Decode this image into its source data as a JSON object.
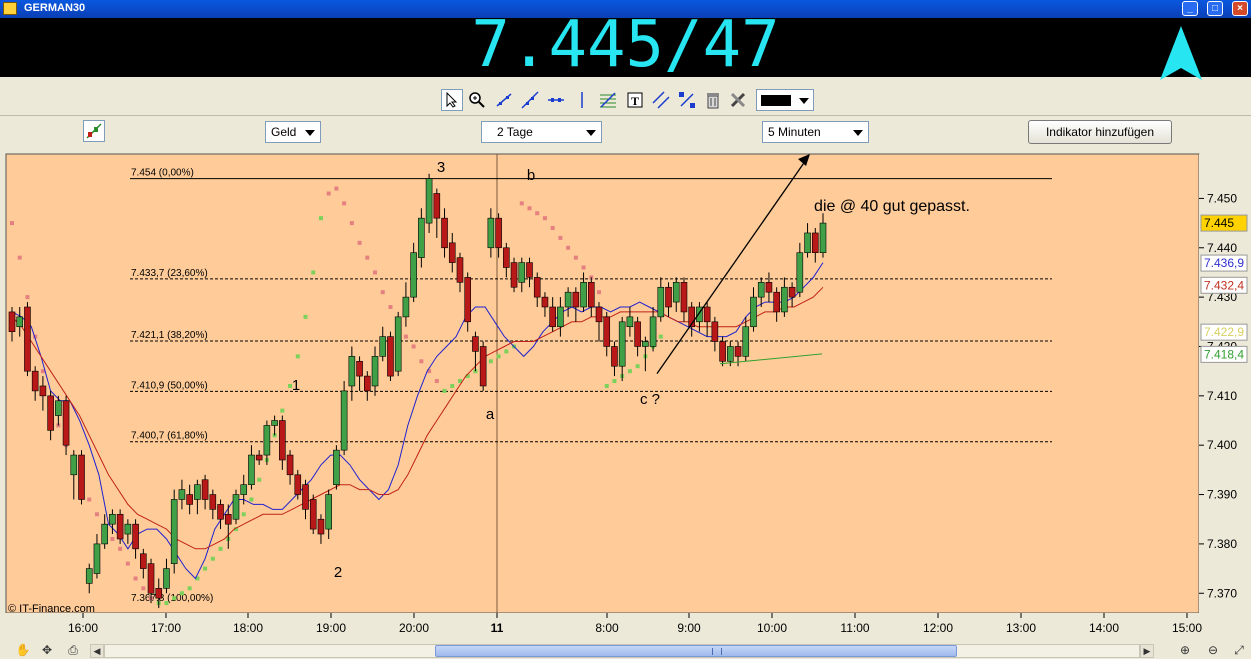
{
  "window": {
    "title": "GERMAN30",
    "buttons": [
      "_",
      "□",
      "×"
    ]
  },
  "quote": {
    "price": "7.445/47",
    "direction_icon": "up-arrow-icon",
    "color": "#27e6f2"
  },
  "toolbar": {
    "tools": [
      "cursor-icon",
      "zoom-icon",
      "line-icon",
      "trendline-icon",
      "horizontal-line-icon",
      "fibonacci-icon",
      "text-icon",
      "parallel-icon",
      "expand-icon",
      "trash-icon",
      "tools-icon"
    ],
    "color_value": "#000000"
  },
  "options": {
    "side": "Geld",
    "range": "2 Tage",
    "interval": "5 Minuten",
    "add_indicator": "Indikator hinzufügen"
  },
  "chart_data": {
    "type": "candlestick",
    "symbol": "GERMAN30",
    "watermark": "© IT-Finance.com",
    "x_labels": [
      "16:00",
      "17:00",
      "18:00",
      "19:00",
      "20:00",
      "11",
      "8:00",
      "9:00",
      "10:00",
      "11:00",
      "12:00",
      "13:00",
      "14:00",
      "15:00"
    ],
    "y_ticks": [
      "7.450",
      "7.440",
      "7.430",
      "7.420",
      "7.410",
      "7.400",
      "7.390",
      "7.380",
      "7.370"
    ],
    "ylim": [
      7.366,
      7.459
    ],
    "price_badges": [
      {
        "label": "7.445",
        "value": 7.445,
        "color": "#ffd200",
        "text": "#000"
      },
      {
        "label": "7.436,9",
        "value": 7.4369,
        "color": "#ffffff",
        "text": "#3030d0"
      },
      {
        "label": "7.432,4",
        "value": 7.4324,
        "color": "#ffffff",
        "text": "#c03020"
      },
      {
        "label": "7.422,9",
        "value": 7.4229,
        "color": "#ffffff",
        "text": "#d8d060"
      },
      {
        "label": "7.418,4",
        "value": 7.4184,
        "color": "#ffffff",
        "text": "#30a030"
      }
    ],
    "fib_levels": [
      {
        "label": "7.454 (0,00%)",
        "value": 7.454
      },
      {
        "label": "7.433,7 (23,60%)",
        "value": 7.4337
      },
      {
        "label": "7.421,1 (38,20%)",
        "value": 7.4211
      },
      {
        "label": "7.410,9 (50,00%)",
        "value": 7.4109
      },
      {
        "label": "7.400,7 (61,80%)",
        "value": 7.4007
      },
      {
        "label": "7.367,8 (100,00%)",
        "value": 7.3678
      }
    ],
    "annotations": [
      {
        "text": "3",
        "id": "wave-3"
      },
      {
        "text": "b",
        "id": "wave-b"
      },
      {
        "text": "1",
        "id": "wave-1"
      },
      {
        "text": "2",
        "id": "wave-2"
      },
      {
        "text": "a",
        "id": "wave-a"
      },
      {
        "text": "c ?",
        "id": "wave-c"
      },
      {
        "text": "die @ 40 gut gepasst.",
        "id": "comment"
      }
    ],
    "candles": [
      [
        7.427,
        7.423,
        7.428,
        7.421
      ],
      [
        7.424,
        7.426,
        7.428,
        7.422
      ],
      [
        7.428,
        7.415,
        7.429,
        7.414
      ],
      [
        7.415,
        7.411,
        7.416,
        7.409
      ],
      [
        7.412,
        7.41,
        7.414,
        7.407
      ],
      [
        7.41,
        7.403,
        7.411,
        7.401
      ],
      [
        7.406,
        7.409,
        7.41,
        7.404
      ],
      [
        7.409,
        7.4,
        7.41,
        7.398
      ],
      [
        7.394,
        7.398,
        7.399,
        7.389
      ],
      [
        7.398,
        7.389,
        7.399,
        7.388
      ],
      [
        7.372,
        7.375,
        7.376,
        7.37
      ],
      [
        7.374,
        7.38,
        7.382,
        7.373
      ],
      [
        7.38,
        7.384,
        7.386,
        7.379
      ],
      [
        7.384,
        7.386,
        7.387,
        7.382
      ],
      [
        7.386,
        7.381,
        7.387,
        7.38
      ],
      [
        7.382,
        7.384,
        7.385,
        7.38
      ],
      [
        7.384,
        7.379,
        7.385,
        7.377
      ],
      [
        7.378,
        7.375,
        7.379,
        7.373
      ],
      [
        7.376,
        7.37,
        7.377,
        7.368
      ],
      [
        7.371,
        7.369,
        7.373,
        7.367
      ],
      [
        7.371,
        7.375,
        7.377,
        7.37
      ],
      [
        7.376,
        7.389,
        7.391,
        7.374
      ],
      [
        7.389,
        7.391,
        7.393,
        7.387
      ],
      [
        7.39,
        7.388,
        7.392,
        7.386
      ],
      [
        7.389,
        7.392,
        7.393,
        7.386
      ],
      [
        7.393,
        7.389,
        7.394,
        7.387
      ],
      [
        7.39,
        7.387,
        7.391,
        7.385
      ],
      [
        7.388,
        7.385,
        7.389,
        7.383
      ],
      [
        7.386,
        7.384,
        7.388,
        7.379
      ],
      [
        7.385,
        7.39,
        7.391,
        7.384
      ],
      [
        7.39,
        7.392,
        7.394,
        7.388
      ],
      [
        7.392,
        7.398,
        7.4,
        7.391
      ],
      [
        7.398,
        7.397,
        7.399,
        7.396
      ],
      [
        7.398,
        7.404,
        7.405,
        7.396
      ],
      [
        7.404,
        7.405,
        7.406,
        7.402
      ],
      [
        7.405,
        7.397,
        7.406,
        7.395
      ],
      [
        7.398,
        7.394,
        7.399,
        7.392
      ],
      [
        7.394,
        7.39,
        7.395,
        7.389
      ],
      [
        7.392,
        7.387,
        7.393,
        7.385
      ],
      [
        7.389,
        7.383,
        7.39,
        7.382
      ],
      [
        7.385,
        7.382,
        7.386,
        7.38
      ],
      [
        7.383,
        7.39,
        7.391,
        7.381
      ],
      [
        7.392,
        7.399,
        7.4,
        7.391
      ],
      [
        7.399,
        7.411,
        7.413,
        7.398
      ],
      [
        7.412,
        7.418,
        7.42,
        7.409
      ],
      [
        7.417,
        7.414,
        7.418,
        7.411
      ],
      [
        7.414,
        7.411,
        7.415,
        7.409
      ],
      [
        7.412,
        7.418,
        7.42,
        7.41
      ],
      [
        7.418,
        7.422,
        7.424,
        7.417
      ],
      [
        7.422,
        7.414,
        7.423,
        7.413
      ],
      [
        7.415,
        7.426,
        7.427,
        7.414
      ],
      [
        7.426,
        7.43,
        7.433,
        7.424
      ],
      [
        7.43,
        7.439,
        7.441,
        7.429
      ],
      [
        7.438,
        7.446,
        7.448,
        7.436
      ],
      [
        7.445,
        7.454,
        7.455,
        7.443
      ],
      [
        7.451,
        7.446,
        7.452,
        7.442
      ],
      [
        7.446,
        7.44,
        7.448,
        7.438
      ],
      [
        7.441,
        7.437,
        7.443,
        7.435
      ],
      [
        7.438,
        7.433,
        7.439,
        7.431
      ],
      [
        7.434,
        7.425,
        7.435,
        7.423
      ],
      [
        7.422,
        7.419,
        7.423,
        7.415
      ],
      [
        7.42,
        7.412,
        7.421,
        7.411
      ],
      [
        7.44,
        7.446,
        7.448,
        7.438
      ],
      [
        7.446,
        7.44,
        7.447,
        7.438
      ],
      [
        7.44,
        7.436,
        7.441,
        7.434
      ],
      [
        7.437,
        7.432,
        7.438,
        7.431
      ],
      [
        7.433,
        7.437,
        7.438,
        7.431
      ],
      [
        7.437,
        7.434,
        7.438,
        7.432
      ],
      [
        7.434,
        7.43,
        7.435,
        7.428
      ],
      [
        7.43,
        7.428,
        7.431,
        7.426
      ],
      [
        7.428,
        7.424,
        7.43,
        7.423
      ],
      [
        7.424,
        7.428,
        7.43,
        7.422
      ],
      [
        7.428,
        7.431,
        7.432,
        7.426
      ],
      [
        7.431,
        7.428,
        7.432,
        7.425
      ],
      [
        7.428,
        7.433,
        7.435,
        7.427
      ],
      [
        7.433,
        7.428,
        7.434,
        7.426
      ],
      [
        7.428,
        7.425,
        7.429,
        7.421
      ],
      [
        7.426,
        7.42,
        7.427,
        7.418
      ],
      [
        7.42,
        7.416,
        7.421,
        7.414
      ],
      [
        7.416,
        7.425,
        7.426,
        7.413
      ],
      [
        7.424,
        7.426,
        7.428,
        7.422
      ],
      [
        7.425,
        7.42,
        7.426,
        7.418
      ],
      [
        7.42,
        7.421,
        7.422,
        7.415
      ],
      [
        7.42,
        7.426,
        7.428,
        7.419
      ],
      [
        7.426,
        7.432,
        7.434,
        7.425
      ],
      [
        7.432,
        7.428,
        7.433,
        7.426
      ],
      [
        7.429,
        7.433,
        7.434,
        7.427
      ],
      [
        7.433,
        7.427,
        7.434,
        7.425
      ],
      [
        7.428,
        7.424,
        7.429,
        7.422
      ],
      [
        7.425,
        7.428,
        7.429,
        7.423
      ],
      [
        7.428,
        7.425,
        7.429,
        7.422
      ],
      [
        7.425,
        7.421,
        7.426,
        7.419
      ],
      [
        7.421,
        7.417,
        7.422,
        7.416
      ],
      [
        7.417,
        7.42,
        7.421,
        7.416
      ],
      [
        7.42,
        7.418,
        7.421,
        7.416
      ],
      [
        7.418,
        7.424,
        7.426,
        7.417
      ],
      [
        7.424,
        7.43,
        7.432,
        7.423
      ],
      [
        7.43,
        7.433,
        7.434,
        7.428
      ],
      [
        7.433,
        7.431,
        7.435,
        7.429
      ],
      [
        7.431,
        7.427,
        7.432,
        7.425
      ],
      [
        7.427,
        7.432,
        7.434,
        7.426
      ],
      [
        7.432,
        7.43,
        7.433,
        7.428
      ],
      [
        7.431,
        7.439,
        7.441,
        7.43
      ],
      [
        7.439,
        7.443,
        7.445,
        7.438
      ],
      [
        7.443,
        7.439,
        7.444,
        7.437
      ],
      [
        7.439,
        7.445,
        7.447,
        7.438
      ]
    ],
    "series": [
      {
        "name": "",
        "color": "#2020d0",
        "values": [
          7.427,
          7.426,
          7.424,
          7.418,
          7.411,
          7.409,
          7.409,
          7.405,
          7.4,
          7.394,
          7.384,
          7.382,
          7.379,
          7.382,
          7.383,
          7.383,
          7.381,
          7.378,
          7.375,
          7.373,
          7.377,
          7.383,
          7.386,
          7.389,
          7.389,
          7.388,
          7.388,
          7.387,
          7.387,
          7.389,
          7.391,
          7.393,
          7.396,
          7.398,
          7.398,
          7.396,
          7.393,
          7.391,
          7.389,
          7.391,
          7.396,
          7.404,
          7.41,
          7.415,
          7.418,
          7.42,
          7.422,
          7.426,
          7.428,
          7.428,
          7.425,
          7.422,
          7.42,
          7.418,
          7.42,
          7.423,
          7.425,
          7.427,
          7.428,
          7.427,
          7.428,
          7.428,
          7.427,
          7.428,
          7.428,
          7.429,
          7.428,
          7.427,
          7.426,
          7.425,
          7.424,
          7.423,
          7.422,
          7.422,
          7.422,
          7.423,
          7.426,
          7.428,
          7.429,
          7.429,
          7.429,
          7.43,
          7.432,
          7.434,
          7.437
        ]
      },
      {
        "name": "",
        "color": "#c02018",
        "values": [
          7.426,
          7.424,
          7.421,
          7.418,
          7.415,
          7.412,
          7.409,
          7.406,
          7.402,
          7.398,
          7.394,
          7.391,
          7.388,
          7.386,
          7.385,
          7.384,
          7.383,
          7.381,
          7.38,
          7.379,
          7.379,
          7.38,
          7.381,
          7.383,
          7.384,
          7.385,
          7.386,
          7.386,
          7.386,
          7.387,
          7.388,
          7.389,
          7.39,
          7.391,
          7.392,
          7.392,
          7.391,
          7.391,
          7.39,
          7.39,
          7.391,
          7.394,
          7.398,
          7.402,
          7.405,
          7.408,
          7.411,
          7.414,
          7.416,
          7.418,
          7.419,
          7.42,
          7.421,
          7.421,
          7.421,
          7.422,
          7.423,
          7.424,
          7.425,
          7.425,
          7.426,
          7.426,
          7.426,
          7.427,
          7.427,
          7.427,
          7.427,
          7.427,
          7.426,
          7.425,
          7.425,
          7.424,
          7.424,
          7.424,
          7.424,
          7.424,
          7.425,
          7.426,
          7.427,
          7.427,
          7.428,
          7.428,
          7.429,
          7.43,
          7.432
        ]
      }
    ],
    "sar_points": [
      [
        7.445,
        0
      ],
      [
        7.438,
        0
      ],
      [
        7.43,
        0
      ],
      [
        7.422,
        0
      ],
      [
        7.415,
        0
      ],
      [
        7.409,
        0
      ],
      [
        7.404,
        0
      ],
      [
        7.4,
        0
      ],
      [
        7.396,
        0
      ],
      [
        7.392,
        0
      ],
      [
        7.389,
        0
      ],
      [
        7.386,
        0
      ],
      [
        7.383,
        0
      ],
      [
        7.381,
        0
      ],
      [
        7.379,
        0
      ],
      [
        7.376,
        0
      ],
      [
        7.373,
        0
      ],
      [
        7.371,
        0
      ],
      [
        7.369,
        0
      ],
      [
        7.368,
        1
      ],
      [
        7.368,
        1
      ],
      [
        7.369,
        1
      ],
      [
        7.37,
        1
      ],
      [
        7.371,
        1
      ],
      [
        7.373,
        1
      ],
      [
        7.375,
        1
      ],
      [
        7.377,
        1
      ],
      [
        7.379,
        1
      ],
      [
        7.381,
        1
      ],
      [
        7.383,
        1
      ],
      [
        7.386,
        1
      ],
      [
        7.389,
        1
      ],
      [
        7.393,
        1
      ],
      [
        7.397,
        1
      ],
      [
        7.402,
        1
      ],
      [
        7.407,
        1
      ],
      [
        7.412,
        1
      ],
      [
        7.418,
        1
      ],
      [
        7.426,
        1
      ],
      [
        7.435,
        1
      ],
      [
        7.446,
        1
      ],
      [
        7.451,
        0
      ],
      [
        7.452,
        0
      ],
      [
        7.449,
        0
      ],
      [
        7.445,
        0
      ],
      [
        7.441,
        0
      ],
      [
        7.438,
        0
      ],
      [
        7.435,
        0
      ],
      [
        7.431,
        0
      ],
      [
        7.428,
        0
      ],
      [
        7.425,
        0
      ],
      [
        7.422,
        0
      ],
      [
        7.42,
        0
      ],
      [
        7.417,
        0
      ],
      [
        7.415,
        0
      ],
      [
        7.413,
        0
      ],
      [
        7.411,
        1
      ],
      [
        7.412,
        1
      ],
      [
        7.413,
        1
      ],
      [
        7.414,
        1
      ],
      [
        7.415,
        1
      ],
      [
        7.416,
        1
      ],
      [
        7.417,
        1
      ],
      [
        7.418,
        1
      ],
      [
        7.419,
        1
      ],
      [
        7.42,
        1
      ],
      [
        7.449,
        0
      ],
      [
        7.448,
        0
      ],
      [
        7.447,
        0
      ],
      [
        7.446,
        0
      ],
      [
        7.444,
        0
      ],
      [
        7.442,
        0
      ],
      [
        7.44,
        0
      ],
      [
        7.438,
        0
      ],
      [
        7.436,
        0
      ],
      [
        7.434,
        0
      ],
      [
        7.431,
        0
      ],
      [
        7.412,
        1
      ],
      [
        7.413,
        1
      ],
      [
        7.414,
        1
      ],
      [
        7.415,
        1
      ],
      [
        7.416,
        1
      ],
      [
        7.418,
        1
      ],
      [
        7.42,
        1
      ],
      [
        7.422,
        1
      ]
    ]
  }
}
